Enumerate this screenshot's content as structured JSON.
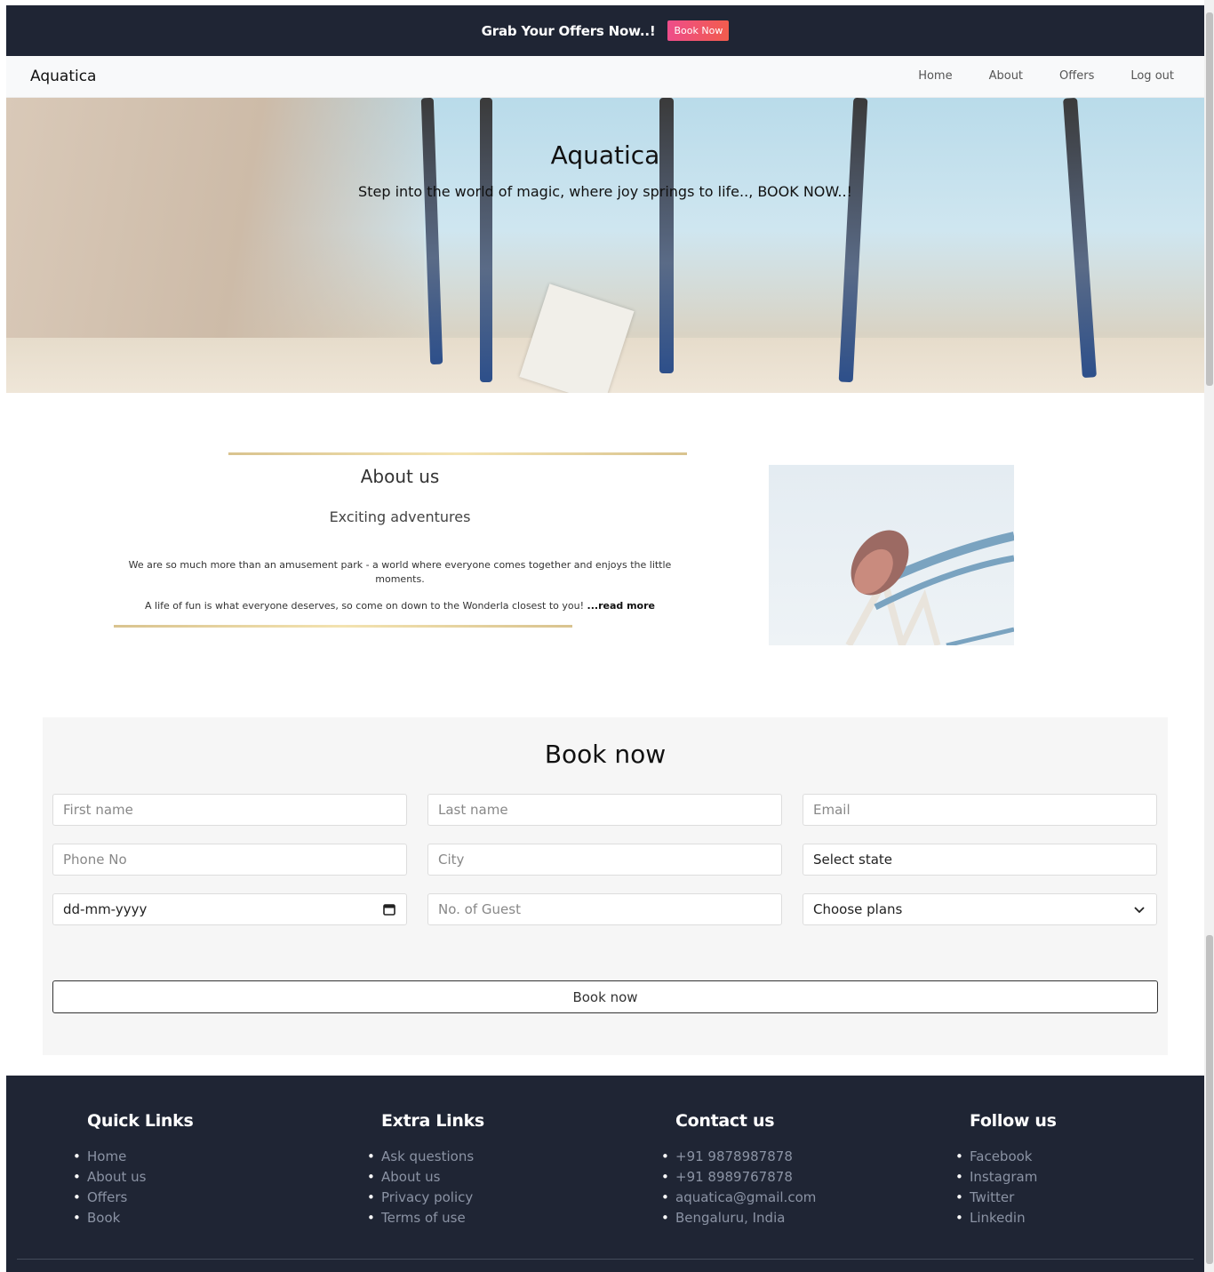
{
  "offer_bar": {
    "text": "Grab Your Offers Now..!",
    "button": "Book Now"
  },
  "navbar": {
    "brand": "Aquatica",
    "links": [
      "Home",
      "About",
      "Offers",
      "Log out"
    ]
  },
  "hero": {
    "title": "Aquatica",
    "subtitle": "Step into the world of magic, where joy springs to life.., BOOK NOW..!"
  },
  "about": {
    "title": "About us",
    "subtitle": "Exciting adventures",
    "paragraph1": "We are so much more than an amusement park - a world where everyone comes together and enjoys the little moments.",
    "paragraph2": "A life of fun is what everyone deserves, so come on down to the Wonderla closest to you! ",
    "read_more": "...read more"
  },
  "booking": {
    "title": "Book now",
    "fields": {
      "first_name": "First name",
      "last_name": "Last name",
      "email": "Email",
      "phone": "Phone No",
      "city": "City",
      "state": "Select state",
      "date": "dd-mm-yyyy",
      "guests": "No. of Guest",
      "plans": "Choose plans"
    },
    "button": "Book now"
  },
  "footer": {
    "quick_links": {
      "title": "Quick Links",
      "items": [
        "Home",
        "About us",
        "Offers",
        "Book"
      ]
    },
    "extra_links": {
      "title": "Extra Links",
      "items": [
        "Ask questions",
        "About us",
        "Privacy policy",
        "Terms of use"
      ]
    },
    "contact": {
      "title": "Contact us",
      "items": [
        "+91 9878987878",
        "+91 8989767878",
        "aquatica@gmail.com",
        "Bengaluru, India"
      ]
    },
    "follow": {
      "title": "Follow us",
      "items": [
        "Facebook",
        "Instagram",
        "Twitter",
        "Linkedin"
      ]
    }
  },
  "icons": {
    "calendar": "calendar-icon",
    "chevron": "chevron-down-icon"
  },
  "colors": {
    "dark_bg": "#1f2534",
    "accent": "#ee4d8a",
    "gold": "#d9c38f"
  }
}
